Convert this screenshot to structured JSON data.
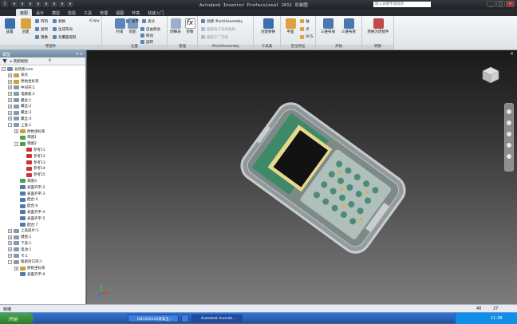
{
  "title_bar": {
    "app_title": "Autodesk Inventor Professional 2011   总装图",
    "search_placeholder": "键入关键字或短语",
    "quick_access": [
      "new-icon",
      "open-icon",
      "save-icon",
      "undo-icon",
      "redo-icon",
      "home-icon",
      "select-icon",
      "color-icon"
    ]
  },
  "menu_tabs": [
    "装配",
    "设计",
    "模型",
    "检验",
    "工具",
    "管理",
    "视图",
    "环境",
    "快速入门"
  ],
  "ribbon": {
    "panels": [
      {
        "label": "零部件",
        "big": [
          {
            "label": "放置"
          },
          {
            "label": "创建"
          }
        ],
        "small": [
          {
            "label": "阵列"
          },
          {
            "label": "替换"
          },
          {
            "label": "复制"
          },
          {
            "label": "生成布局"
          },
          {
            "label": "镜像"
          },
          {
            "label": "包覆面提取"
          },
          {
            "label": "iCopy"
          }
        ]
      },
      {
        "label": "位置",
        "big": [
          {
            "label": "约束"
          },
          {
            "label": "装配"
          }
        ],
        "small": [
          {
            "label": "关节"
          },
          {
            "label": "表达"
          },
          {
            "label": "自由移动"
          },
          {
            "label": "移动"
          },
          {
            "label": "旋转"
          }
        ]
      },
      {
        "label": "管理",
        "big": [
          {
            "label": "明细表"
          },
          {
            "label": "参数"
          }
        ],
        "small": []
      },
      {
        "label": "iPart/iAssembly",
        "big": [],
        "small": [
          {
            "label": "创建 iPart/iAssembly"
          },
          {
            "label": "编辑电子表格编辑"
          },
          {
            "label": "编辑工厂范围"
          }
        ]
      },
      {
        "label": "工具集",
        "big": [
          {
            "label": "创建替换"
          }
        ],
        "small": []
      },
      {
        "label": "定位特征",
        "big": [
          {
            "label": "平面"
          }
        ],
        "small": [
          {
            "label": "轴"
          },
          {
            "label": "点"
          },
          {
            "label": "UCS"
          }
        ]
      },
      {
        "label": "开始",
        "big": [
          {
            "label": "三维布线"
          },
          {
            "label": "三维布管"
          }
        ],
        "small": []
      },
      {
        "label": "转换",
        "big": [
          {
            "label": "转换为焊接件"
          }
        ],
        "small": []
      }
    ]
  },
  "browser": {
    "header_title": "模型",
    "view_label": "装配视图",
    "tree": [
      {
        "label": "总装图.iam",
        "level": 0,
        "expand": "-",
        "root": true
      },
      {
        "label": "表达",
        "level": 1,
        "expand": "+",
        "color": "#c8a03c"
      },
      {
        "label": "原始坐标系",
        "level": 1,
        "expand": "+",
        "color": "#c8a03c"
      },
      {
        "label": "中间壳:1",
        "level": 1,
        "expand": "+",
        "color": "#8899aa"
      },
      {
        "label": "电路板:1",
        "level": 1,
        "expand": "+",
        "color": "#8899aa"
      },
      {
        "label": "螺丝:1",
        "level": 1,
        "expand": "+",
        "color": "#8899aa"
      },
      {
        "label": "螺丝:2",
        "level": 1,
        "expand": "+",
        "color": "#8899aa"
      },
      {
        "label": "螺丝:3",
        "level": 1,
        "expand": "+",
        "color": "#8899aa"
      },
      {
        "label": "螺丝:4",
        "level": 1,
        "expand": "+",
        "color": "#8899aa"
      },
      {
        "label": "上盖:1",
        "level": 1,
        "expand": "-",
        "color": "#8899aa"
      },
      {
        "label": "原始坐标系",
        "level": 2,
        "expand": "+",
        "color": "#c8a03c"
      },
      {
        "label": "草图1",
        "level": 2,
        "expand": "",
        "color": "#4aa14a"
      },
      {
        "label": "草图2",
        "level": 2,
        "expand": "-",
        "color": "#4aa14a"
      },
      {
        "label": "参考11",
        "level": 3,
        "expand": "",
        "color": "#cc3333"
      },
      {
        "label": "参考12",
        "level": 3,
        "expand": "",
        "color": "#cc3333"
      },
      {
        "label": "参考13",
        "level": 3,
        "expand": "",
        "color": "#cc3333"
      },
      {
        "label": "参考14",
        "level": 3,
        "expand": "",
        "color": "#cc3333"
      },
      {
        "label": "参考15",
        "level": 3,
        "expand": "",
        "color": "#cc3333"
      },
      {
        "label": "草图3",
        "level": 2,
        "expand": "",
        "color": "#4aa14a"
      },
      {
        "label": "表面齐平:2",
        "level": 2,
        "expand": "",
        "color": "#5577aa"
      },
      {
        "label": "表面齐平:3",
        "level": 2,
        "expand": "",
        "color": "#5577aa"
      },
      {
        "label": "配合:4",
        "level": 2,
        "expand": "",
        "color": "#5577aa"
      },
      {
        "label": "配合:6",
        "level": 2,
        "expand": "",
        "color": "#5577aa"
      },
      {
        "label": "表面齐平:4",
        "level": 2,
        "expand": "",
        "color": "#5577aa"
      },
      {
        "label": "表面齐平:5",
        "level": 2,
        "expand": "",
        "color": "#5577aa"
      },
      {
        "label": "配合:7",
        "level": 2,
        "expand": "",
        "color": "#5577aa"
      },
      {
        "label": "上盖屏片:1",
        "level": 1,
        "expand": "+",
        "color": "#8899aa"
      },
      {
        "label": "键盘:1",
        "level": 1,
        "expand": "+",
        "color": "#8899aa"
      },
      {
        "label": "下盖:1",
        "level": 1,
        "expand": "+",
        "color": "#8899aa"
      },
      {
        "label": "电池:1",
        "level": 1,
        "expand": "+",
        "color": "#8899aa"
      },
      {
        "label": "卡:1",
        "level": 1,
        "expand": "+",
        "color": "#8899aa"
      },
      {
        "label": "尾部封口壳:1",
        "level": 1,
        "expand": "-",
        "color": "#8899aa"
      },
      {
        "label": "原始坐标系",
        "level": 2,
        "expand": "+",
        "color": "#c8a03c"
      },
      {
        "label": "表面齐平:9",
        "level": 2,
        "expand": "",
        "color": "#5577aa"
      }
    ]
  },
  "status_bar": {
    "status": "就绪",
    "num1": "40",
    "num2": "27"
  },
  "taskbar": {
    "start_label": "开始",
    "tasks": [
      {
        "label": "D85200105某案主..."
      },
      {
        "label": ""
      },
      {
        "label": "Autodesk Invento..."
      }
    ],
    "clock": "11:38"
  }
}
